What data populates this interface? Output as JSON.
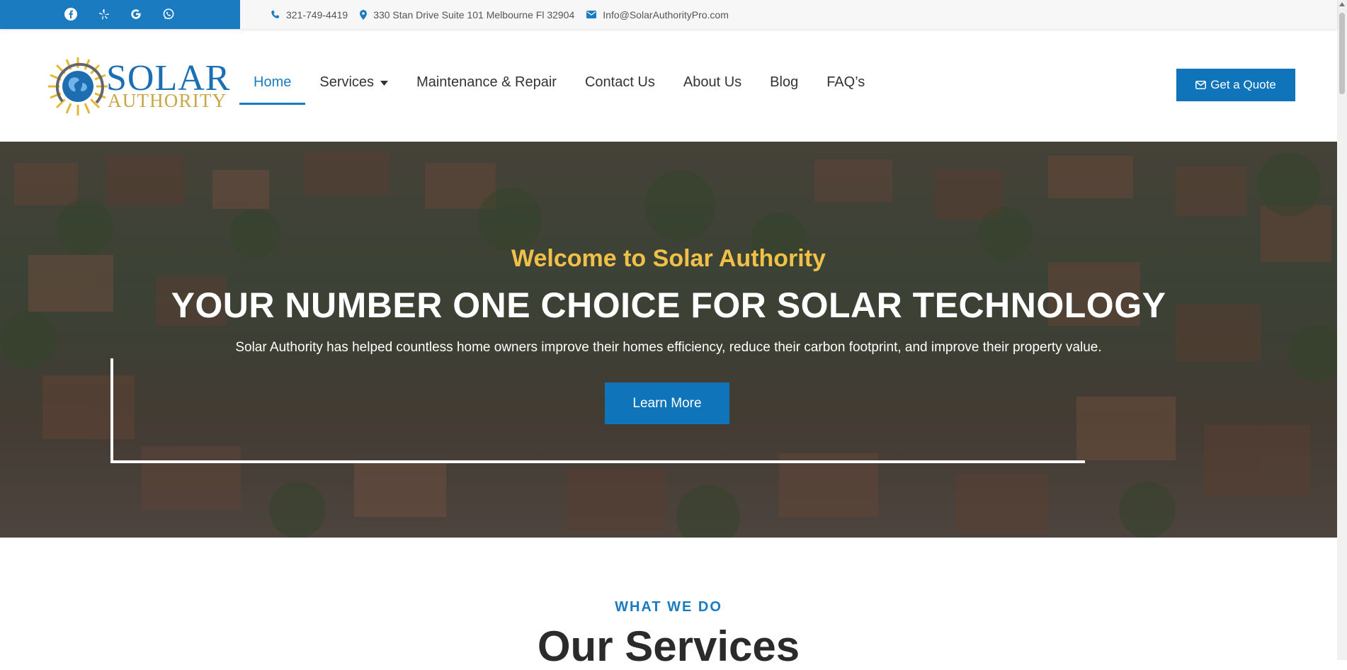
{
  "colors": {
    "brand_blue": "#1a7bc1",
    "accent_gold": "#f1c048",
    "button_blue": "#1074bb"
  },
  "social": [
    {
      "icon": "facebook-icon"
    },
    {
      "icon": "yelp-icon"
    },
    {
      "icon": "google-icon"
    },
    {
      "icon": "whatsapp-icon"
    }
  ],
  "contact": {
    "phone": "321-749-4419",
    "address": "330 Stan Drive Suite 101 Melbourne Fl 32904",
    "email": "Info@SolarAuthorityPro.com"
  },
  "logo": {
    "word1": "SOLAR",
    "word2": "AUTHORITY"
  },
  "nav": {
    "home": "Home",
    "services": "Services",
    "maintenance": "Maintenance & Repair",
    "contact": "Contact Us",
    "about": "About Us",
    "blog": "Blog",
    "faq": "FAQ’s"
  },
  "quote_button": "Get a Quote",
  "hero": {
    "subtitle": "Welcome to Solar Authority",
    "title": "YOUR NUMBER ONE CHOICE FOR SOLAR TECHNOLOGY",
    "text": "Solar Authority has helped countless home owners improve their homes efficiency, reduce their carbon footprint, and improve their property value.",
    "button": "Learn More"
  },
  "services_section": {
    "eyebrow": "WHAT WE DO",
    "heading": "Our Services"
  }
}
